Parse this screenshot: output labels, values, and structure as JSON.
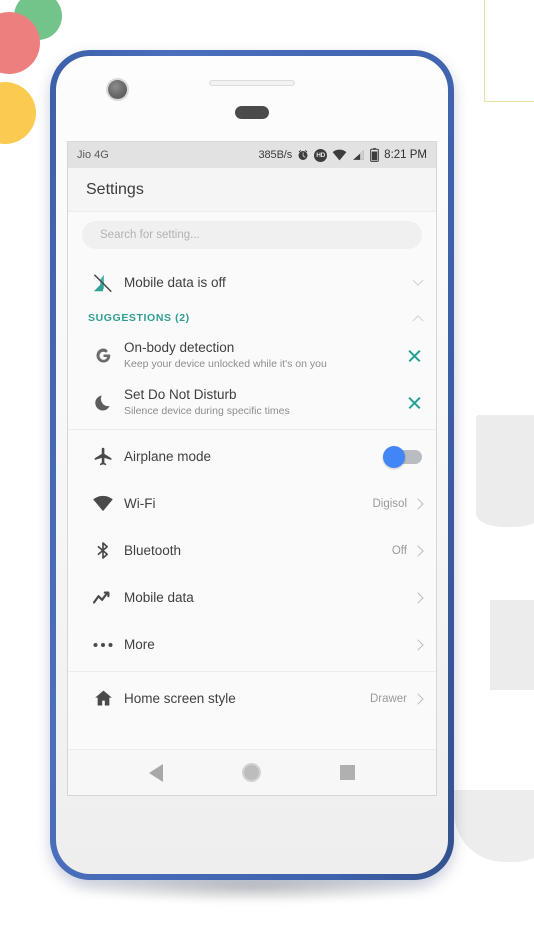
{
  "colors": {
    "phone_frame": "#3f62ad",
    "accent_teal": "#22a094",
    "toggle_blue": "#4285f4",
    "dot_green": "#72c48a",
    "dot_red": "#ee7f7f",
    "dot_yellow": "#fbcb51"
  },
  "status_bar": {
    "carrier": "Jio 4G",
    "network_speed": "385B/s",
    "alarm_icon": "alarm-clock-icon",
    "hd_badge": "HD",
    "wifi_icon": "wifi-icon",
    "signal_icon": "cellular-signal-icon",
    "battery_icon": "battery-icon",
    "time": "8:21 PM"
  },
  "app_bar": {
    "title": "Settings"
  },
  "search": {
    "placeholder": "Search for setting...",
    "value": ""
  },
  "status_row": {
    "icon": "mobile-data-off-icon",
    "title": "Mobile data is off",
    "expander": "chevron-down-icon"
  },
  "suggestions": {
    "header": "SUGGESTIONS (2)",
    "collapse_icon": "chevron-up-icon",
    "items": [
      {
        "icon": "google-g-icon",
        "title": "On-body detection",
        "subtitle": "Keep your device unlocked while it's on you",
        "dismiss": "close-icon"
      },
      {
        "icon": "crescent-moon-icon",
        "title": "Set Do Not Disturb",
        "subtitle": "Silence device during specific times",
        "dismiss": "close-icon"
      }
    ]
  },
  "settings_list": [
    {
      "icon": "airplane-icon",
      "title": "Airplane mode",
      "value": "",
      "control": "toggle",
      "toggle_on": false
    },
    {
      "icon": "wifi-icon",
      "title": "Wi-Fi",
      "value": "Digisol",
      "control": "chevron"
    },
    {
      "icon": "bluetooth-icon",
      "title": "Bluetooth",
      "value": "Off",
      "control": "chevron"
    },
    {
      "icon": "mobile-data-icon",
      "title": "Mobile data",
      "value": "",
      "control": "chevron"
    },
    {
      "icon": "more-dots-icon",
      "title": "More",
      "value": "",
      "control": "chevron"
    },
    {
      "icon": "home-icon",
      "title": "Home screen style",
      "value": "Drawer",
      "control": "chevron"
    }
  ],
  "nav_bar": {
    "back": "back-triangle-icon",
    "home": "home-circle-icon",
    "recents": "recents-square-icon"
  }
}
